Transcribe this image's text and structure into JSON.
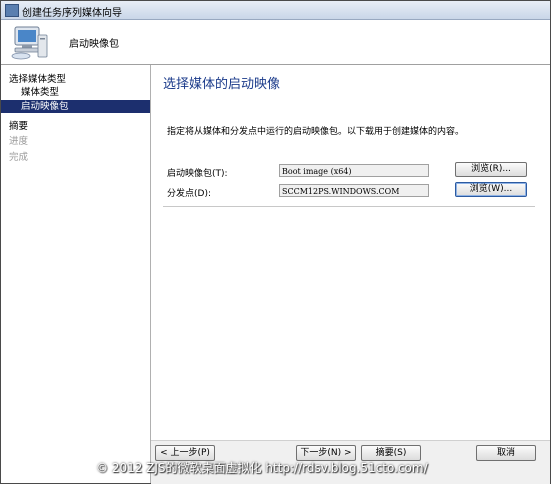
{
  "window": {
    "title": "创建任务序列媒体向导"
  },
  "header": {
    "title": "启动映像包",
    "icon": "computer-wizard-icon"
  },
  "nav": {
    "items": [
      {
        "label": "选择媒体类型",
        "state": "normal"
      },
      {
        "label": "媒体类型",
        "state": "normal"
      },
      {
        "label": "启动映像包",
        "state": "selected"
      },
      {
        "label": "摘要",
        "state": "normal"
      },
      {
        "label": "进度",
        "state": "disabled"
      },
      {
        "label": "完成",
        "state": "disabled"
      }
    ]
  },
  "main": {
    "page_title": "选择媒体的启动映像",
    "description": "指定将从媒体和分发点中运行的启动映像包。以下载用于创建媒体的内容。",
    "boot_image_label": "启动映像包(T):",
    "boot_image_value": "Boot image (x64)",
    "browse_boot_label": "浏览(R)...",
    "dp_label": "分发点(D):",
    "dp_value": "SCCM12PS.WINDOWS.COM",
    "browse_dp_label": "浏览(W)..."
  },
  "footer": {
    "prev_label": "< 上一步(P)",
    "next_label": "下一步(N) >",
    "summary_label": "摘要(S)",
    "cancel_label": "取消"
  },
  "watermark": "© 2012 ZJS的微软桌面虚拟化 http://rdsv.blog.51cto.com/",
  "colors": {
    "nav_selected": "#1c2f6e",
    "page_title": "#1a3a8a"
  }
}
